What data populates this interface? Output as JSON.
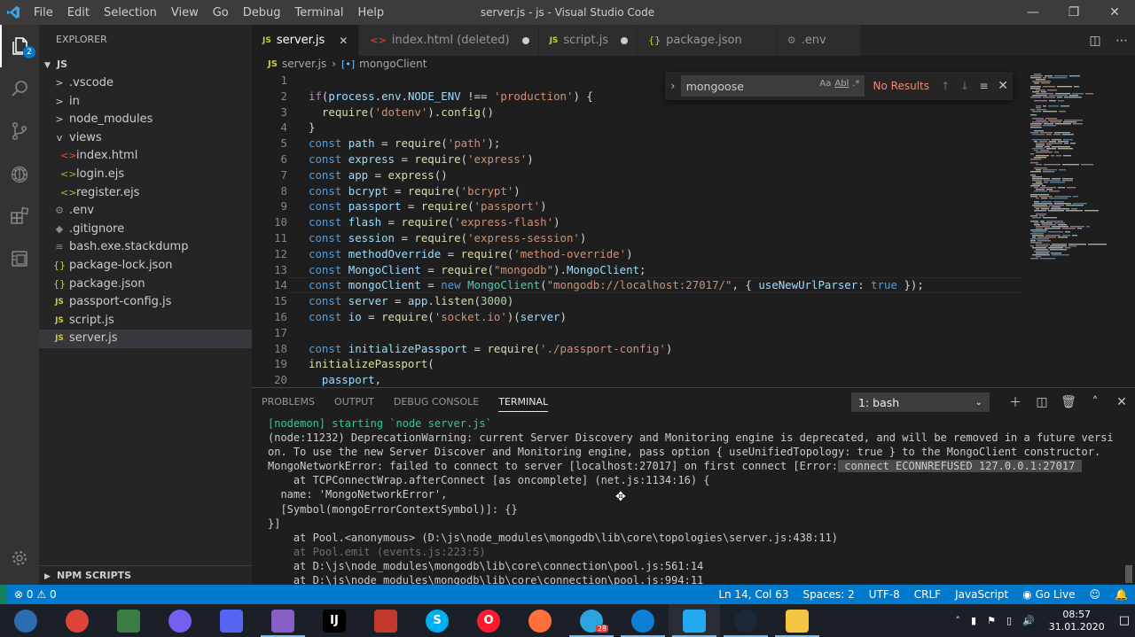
{
  "titlebar": {
    "menu": [
      "File",
      "Edit",
      "Selection",
      "View",
      "Go",
      "Debug",
      "Terminal",
      "Help"
    ],
    "title": "server.js - js - Visual Studio Code"
  },
  "activity": {
    "explorer_badge": "2"
  },
  "sidebar": {
    "header": "EXPLORER",
    "root": "JS",
    "items": [
      {
        "label": ".vscode",
        "kind": "folder",
        "depth": 1,
        "icon": ">"
      },
      {
        "label": "in",
        "kind": "folder",
        "depth": 1,
        "icon": ">"
      },
      {
        "label": "node_modules",
        "kind": "folder",
        "depth": 1,
        "icon": ">"
      },
      {
        "label": "views",
        "kind": "folder-open",
        "depth": 1,
        "icon": "v"
      },
      {
        "label": "index.html",
        "kind": "html",
        "depth": 2,
        "icon": "<>"
      },
      {
        "label": "login.ejs",
        "kind": "ejs",
        "depth": 2,
        "icon": "<>"
      },
      {
        "label": "register.ejs",
        "kind": "ejs",
        "depth": 2,
        "icon": "<>"
      },
      {
        "label": ".env",
        "kind": "env",
        "depth": 1,
        "icon": "⚙"
      },
      {
        "label": ".gitignore",
        "kind": "git",
        "depth": 1,
        "icon": "◆"
      },
      {
        "label": "bash.exe.stackdump",
        "kind": "dump",
        "depth": 1,
        "icon": "≡"
      },
      {
        "label": "package-lock.json",
        "kind": "json",
        "depth": 1,
        "icon": "{}"
      },
      {
        "label": "package.json",
        "kind": "json",
        "depth": 1,
        "icon": "{}"
      },
      {
        "label": "passport-config.js",
        "kind": "js",
        "depth": 1,
        "icon": "JS"
      },
      {
        "label": "script.js",
        "kind": "js",
        "depth": 1,
        "icon": "JS"
      },
      {
        "label": "server.js",
        "kind": "js",
        "depth": 1,
        "icon": "JS",
        "selected": true
      }
    ],
    "npm_scripts": "NPM SCRIPTS"
  },
  "tabs": [
    {
      "label": "server.js",
      "icon": "JS",
      "icon_color": "#cbcb41",
      "active": true,
      "state": "close"
    },
    {
      "label": "index.html (deleted)",
      "icon": "<>",
      "icon_color": "#e44d26",
      "active": false,
      "state": "dirty"
    },
    {
      "label": "script.js",
      "icon": "JS",
      "icon_color": "#cbcb41",
      "active": false,
      "state": "dirty"
    },
    {
      "label": "package.json",
      "icon": "{}",
      "icon_color": "#cbcb41",
      "active": false,
      "state": "none"
    },
    {
      "label": ".env",
      "icon": "⚙",
      "icon_color": "#8a8a8a",
      "active": false,
      "state": "none"
    }
  ],
  "breadcrumb": {
    "file": "server.js",
    "symbol": "mongoClient"
  },
  "find": {
    "query": "mongoose",
    "opt_case": "Aa",
    "opt_word": "Abl",
    "opt_regex": ".*",
    "result": "No Results"
  },
  "code_lines": [
    {
      "n": "1",
      "tokens": []
    },
    {
      "n": "2",
      "tokens": [
        [
          "ctl",
          "if"
        ],
        [
          "",
          "("
        ],
        [
          "var",
          "process"
        ],
        [
          "",
          "."
        ],
        [
          "var",
          "env"
        ],
        [
          "",
          "."
        ],
        [
          "var",
          "NODE_ENV"
        ],
        [
          "",
          " !== "
        ],
        [
          "str",
          "'production'"
        ],
        [
          "",
          ") {"
        ]
      ]
    },
    {
      "n": "3",
      "tokens": [
        [
          "",
          "  "
        ],
        [
          "fn",
          "require"
        ],
        [
          "",
          "("
        ],
        [
          "str",
          "'dotenv'"
        ],
        [
          "",
          ")."
        ],
        [
          "fn",
          "config"
        ],
        [
          "",
          "()"
        ]
      ]
    },
    {
      "n": "4",
      "tokens": [
        [
          "",
          "}"
        ]
      ]
    },
    {
      "n": "5",
      "tokens": [
        [
          "kw",
          "const "
        ],
        [
          "var",
          "path"
        ],
        [
          "",
          " = "
        ],
        [
          "fn",
          "require"
        ],
        [
          "",
          "("
        ],
        [
          "str",
          "'path'"
        ],
        [
          "",
          ");"
        ]
      ]
    },
    {
      "n": "6",
      "tokens": [
        [
          "kw",
          "const "
        ],
        [
          "var",
          "express"
        ],
        [
          "",
          " = "
        ],
        [
          "fn",
          "require"
        ],
        [
          "",
          "("
        ],
        [
          "str",
          "'express'"
        ],
        [
          "",
          ")"
        ]
      ]
    },
    {
      "n": "7",
      "tokens": [
        [
          "kw",
          "const "
        ],
        [
          "var",
          "app"
        ],
        [
          "",
          " = "
        ],
        [
          "fn",
          "express"
        ],
        [
          "",
          "()"
        ]
      ]
    },
    {
      "n": "8",
      "tokens": [
        [
          "kw",
          "const "
        ],
        [
          "var",
          "bcrypt"
        ],
        [
          "",
          " = "
        ],
        [
          "fn",
          "require"
        ],
        [
          "",
          "("
        ],
        [
          "str",
          "'bcrypt'"
        ],
        [
          "",
          ")"
        ]
      ]
    },
    {
      "n": "9",
      "tokens": [
        [
          "kw",
          "const "
        ],
        [
          "var",
          "passport"
        ],
        [
          "",
          " = "
        ],
        [
          "fn",
          "require"
        ],
        [
          "",
          "("
        ],
        [
          "str",
          "'passport'"
        ],
        [
          "",
          ")"
        ]
      ]
    },
    {
      "n": "10",
      "tokens": [
        [
          "kw",
          "const "
        ],
        [
          "var",
          "flash"
        ],
        [
          "",
          " = "
        ],
        [
          "fn",
          "require"
        ],
        [
          "",
          "("
        ],
        [
          "str",
          "'express-flash'"
        ],
        [
          "",
          ")"
        ]
      ]
    },
    {
      "n": "11",
      "tokens": [
        [
          "kw",
          "const "
        ],
        [
          "var",
          "session"
        ],
        [
          "",
          " = "
        ],
        [
          "fn",
          "require"
        ],
        [
          "",
          "("
        ],
        [
          "str",
          "'express-session'"
        ],
        [
          "",
          ")"
        ]
      ]
    },
    {
      "n": "12",
      "tokens": [
        [
          "kw",
          "const "
        ],
        [
          "var",
          "methodOverride"
        ],
        [
          "",
          " = "
        ],
        [
          "fn",
          "require"
        ],
        [
          "",
          "("
        ],
        [
          "str",
          "'method-override'"
        ],
        [
          "",
          ")"
        ]
      ]
    },
    {
      "n": "13",
      "tokens": [
        [
          "kw",
          "const "
        ],
        [
          "var",
          "MongoClient"
        ],
        [
          "",
          " = "
        ],
        [
          "fn",
          "require"
        ],
        [
          "",
          "("
        ],
        [
          "str",
          "\"mongodb\""
        ],
        [
          "",
          ")."
        ],
        [
          "var",
          "MongoClient"
        ],
        [
          "",
          ";"
        ]
      ]
    },
    {
      "n": "14",
      "tokens": [
        [
          "kw",
          "const "
        ],
        [
          "var",
          "mongoClient"
        ],
        [
          "",
          " = "
        ],
        [
          "kw",
          "new "
        ],
        [
          "cls",
          "MongoClient"
        ],
        [
          "",
          "("
        ],
        [
          "str",
          "\"mongodb://localhost:27017/\""
        ],
        [
          "",
          ", { "
        ],
        [
          "var",
          "useNewUrlParser"
        ],
        [
          "",
          ": "
        ],
        [
          "kw",
          "true"
        ],
        [
          "",
          " });"
        ]
      ]
    },
    {
      "n": "15",
      "tokens": [
        [
          "kw",
          "const "
        ],
        [
          "var",
          "server"
        ],
        [
          "",
          " = "
        ],
        [
          "var",
          "app"
        ],
        [
          "",
          "."
        ],
        [
          "fn",
          "listen"
        ],
        [
          "",
          "("
        ],
        [
          "num",
          "3000"
        ],
        [
          "",
          ")"
        ]
      ]
    },
    {
      "n": "16",
      "tokens": [
        [
          "kw",
          "const "
        ],
        [
          "var",
          "io"
        ],
        [
          "",
          " = "
        ],
        [
          "fn",
          "require"
        ],
        [
          "",
          "("
        ],
        [
          "str",
          "'socket.io'"
        ],
        [
          "",
          ")("
        ],
        [
          "var",
          "server"
        ],
        [
          "",
          ")"
        ]
      ]
    },
    {
      "n": "17",
      "tokens": []
    },
    {
      "n": "18",
      "tokens": [
        [
          "kw",
          "const "
        ],
        [
          "var",
          "initializePassport"
        ],
        [
          "",
          " = "
        ],
        [
          "fn",
          "require"
        ],
        [
          "",
          "("
        ],
        [
          "str",
          "'./passport-config'"
        ],
        [
          "",
          ")"
        ]
      ]
    },
    {
      "n": "19",
      "tokens": [
        [
          "fn",
          "initializePassport"
        ],
        [
          "",
          "("
        ]
      ]
    },
    {
      "n": "20",
      "tokens": [
        [
          "",
          "  "
        ],
        [
          "var",
          "passport"
        ],
        [
          "",
          ","
        ]
      ]
    }
  ],
  "panel": {
    "tabs": [
      "PROBLEMS",
      "OUTPUT",
      "DEBUG CONSOLE",
      "TERMINAL"
    ],
    "active_tab": "TERMINAL",
    "terminal_select": "1: bash"
  },
  "terminal_lines": [
    {
      "text": "[nodemon] starting `node server.js`",
      "style": "green"
    },
    {
      "text": "(node:11232) DeprecationWarning: current Server Discovery and Monitoring engine is deprecated, and will be removed in a future versi",
      "style": ""
    },
    {
      "text": "on. To use the new Server Discover and Monitoring engine, pass option { useUnifiedTopology: true } to the MongoClient constructor.",
      "style": ""
    },
    {
      "text": "MongoNetworkError: failed to connect to server [localhost:27017] on first connect [Error:",
      "hl": " connect ECONNREFUSED 127.0.0.1:27017 ",
      "style": ""
    },
    {
      "text": "    at TCPConnectWrap.afterConnect [as oncomplete] (net.js:1134:16) {",
      "style": ""
    },
    {
      "text": "  name: 'MongoNetworkError',",
      "style": ""
    },
    {
      "text": "  [Symbol(mongoErrorContextSymbol)]: {}",
      "style": ""
    },
    {
      "text": "}]",
      "style": ""
    },
    {
      "text": "    at Pool.<anonymous> (D:\\js\\node_modules\\mongodb\\lib\\core\\topologies\\server.js:438:11)",
      "style": ""
    },
    {
      "text": "    at Pool.emit (events.js:223:5)",
      "style": "dim"
    },
    {
      "text": "    at D:\\js\\node_modules\\mongodb\\lib\\core\\connection\\pool.js:561:14",
      "style": ""
    },
    {
      "text": "    at D:\\js\\node_modules\\mongodb\\lib\\core\\connection\\pool.js:994:11",
      "style": ""
    }
  ],
  "status": {
    "errors": "0",
    "warnings": "0",
    "position": "Ln 14, Col 63",
    "spaces": "Spaces: 2",
    "encoding": "UTF-8",
    "eol": "CRLF",
    "language": "JavaScript",
    "golive": "Go Live"
  },
  "taskbar": {
    "apps": [
      {
        "name": "start-button",
        "label": "",
        "color": "#2b6cb0"
      },
      {
        "name": "chrome-icon",
        "label": "",
        "color": "#db4437"
      },
      {
        "name": "cashier-app-icon",
        "label": "",
        "color": "#3a7d44"
      },
      {
        "name": "viber-icon",
        "label": "",
        "color": "#7360f2"
      },
      {
        "name": "discord-icon",
        "label": "",
        "color": "#5865f2"
      },
      {
        "name": "visual-studio-icon",
        "label": "",
        "color": "#865fc5"
      },
      {
        "name": "intellij-icon",
        "label": "IJ",
        "color": "#000000"
      },
      {
        "name": "snipping-tool-icon",
        "label": "",
        "color": "#c0392b"
      },
      {
        "name": "skype-icon",
        "label": "S",
        "color": "#00aff0"
      },
      {
        "name": "opera-icon",
        "label": "O",
        "color": "#ff1b2d"
      },
      {
        "name": "firefox-icon",
        "label": "",
        "color": "#ff7139"
      },
      {
        "name": "telegram-icon",
        "label": "",
        "color": "#2aa3de"
      },
      {
        "name": "edge-icon",
        "label": "",
        "color": "#0f7fd6"
      },
      {
        "name": "vscode-taskbar-icon",
        "label": "",
        "color": "#23a9f2"
      },
      {
        "name": "steam-icon",
        "label": "",
        "color": "#1b2838"
      },
      {
        "name": "file-explorer-icon",
        "label": "",
        "color": "#f4c542"
      }
    ],
    "telegram_badge": "28",
    "time": "08:57",
    "date": "31.01.2020"
  }
}
